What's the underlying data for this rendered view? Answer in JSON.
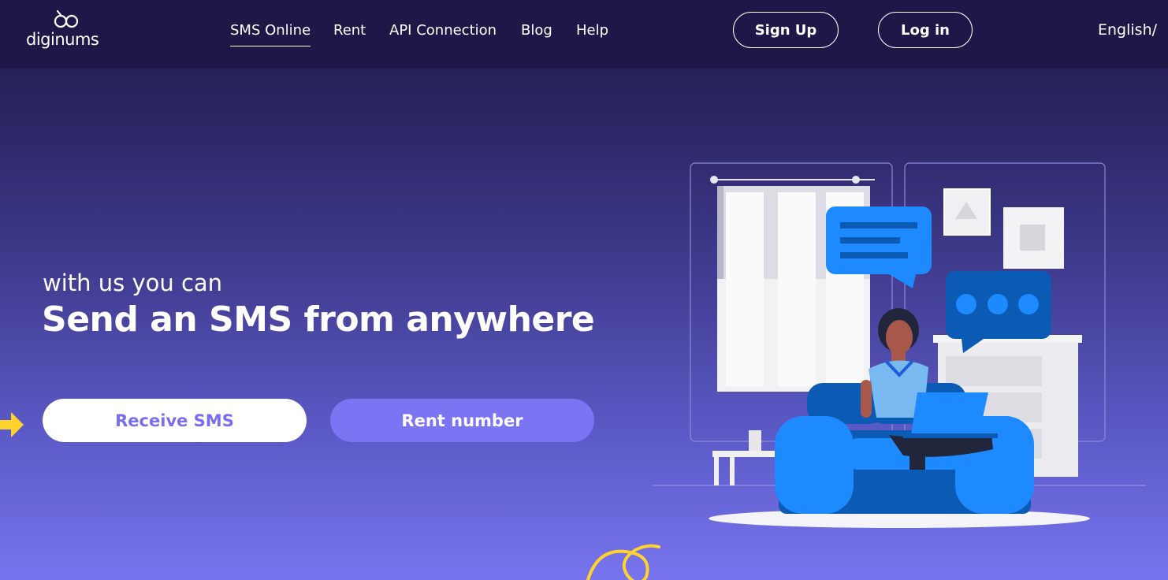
{
  "brand": {
    "name": "diginums"
  },
  "nav": {
    "items": [
      {
        "label": "SMS Online",
        "active": true
      },
      {
        "label": "Rent"
      },
      {
        "label": "API Connection"
      },
      {
        "label": "Blog"
      },
      {
        "label": "Help"
      }
    ],
    "signup_label": "Sign Up",
    "login_label": "Log in",
    "language": "English/"
  },
  "hero": {
    "subtitle": "with us you can",
    "title": "Send an SMS from anywhere",
    "receive_button": "Receive SMS",
    "rent_button": "Rent number"
  },
  "colors": {
    "topbar": "#1e1848",
    "accent": "#7c74f2",
    "button_text_accent": "#7a6ef0",
    "illustration_blue": "#1d8bff",
    "illustration_dark_blue": "#0b5bb5",
    "arrow_yellow": "#ffd22e"
  },
  "icons": [
    "brand-logo-icon",
    "arrow-right-icon",
    "swirl-decoration-icon"
  ]
}
